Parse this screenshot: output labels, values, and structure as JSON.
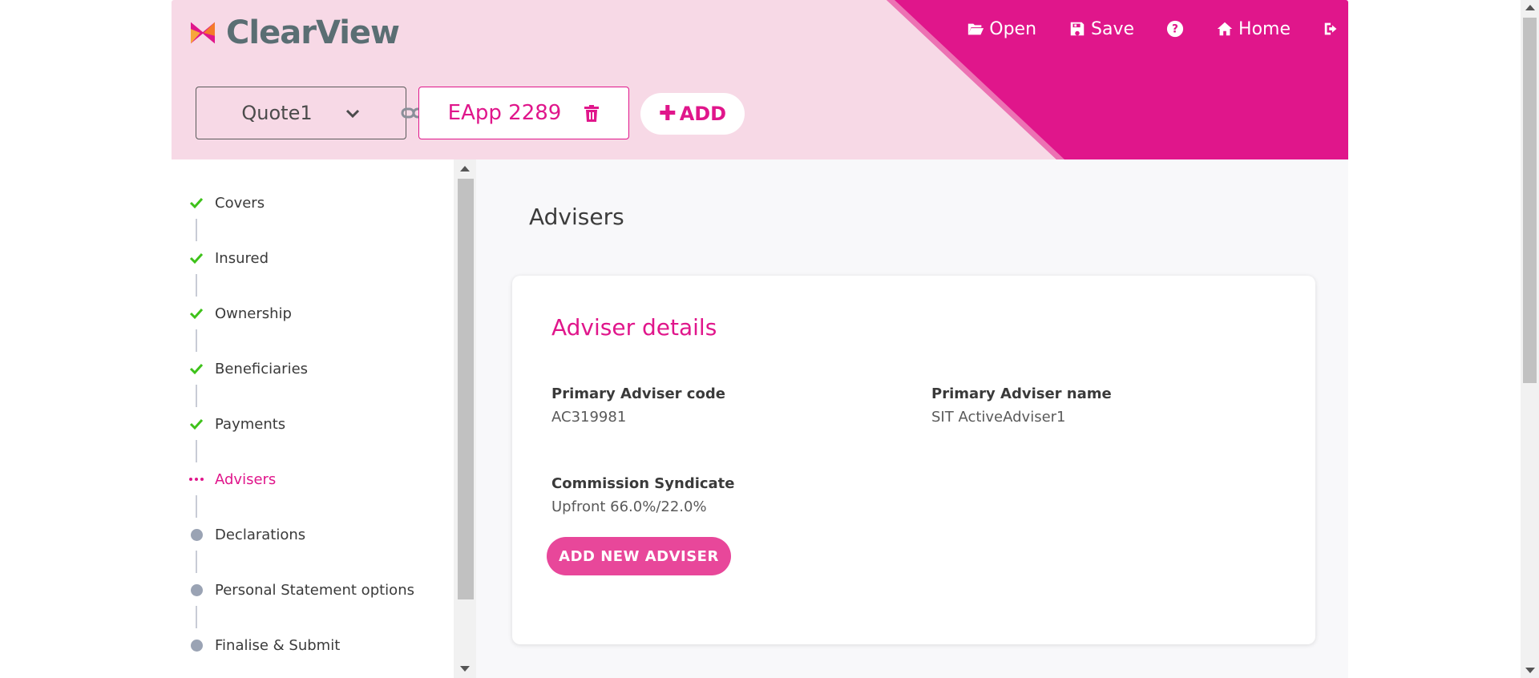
{
  "brand": {
    "name": "ClearView",
    "accent": "#e0168b"
  },
  "topnav": {
    "open": "Open",
    "save": "Save",
    "home": "Home"
  },
  "tabs": {
    "quote": "Quote1",
    "eapp": "EApp 2289",
    "add": "ADD"
  },
  "steps": [
    {
      "label": "Covers",
      "status": "complete"
    },
    {
      "label": "Insured",
      "status": "complete"
    },
    {
      "label": "Ownership",
      "status": "complete"
    },
    {
      "label": "Beneficiaries",
      "status": "complete"
    },
    {
      "label": "Payments",
      "status": "complete"
    },
    {
      "label": "Advisers",
      "status": "in-progress"
    },
    {
      "label": "Declarations",
      "status": "pending"
    },
    {
      "label": "Personal Statement options",
      "status": "pending"
    },
    {
      "label": "Finalise & Submit",
      "status": "pending"
    }
  ],
  "main": {
    "title": "Advisers",
    "card": {
      "title": "Adviser details",
      "primary_code_label": "Primary Adviser code",
      "primary_code_value": "AC319981",
      "primary_name_label": "Primary Adviser name",
      "primary_name_value": "SIT ActiveAdviser1",
      "syndicate_label": "Commission Syndicate",
      "syndicate_value": "Upfront 66.0%/22.0%",
      "add_button": "ADD NEW ADVISER"
    }
  }
}
